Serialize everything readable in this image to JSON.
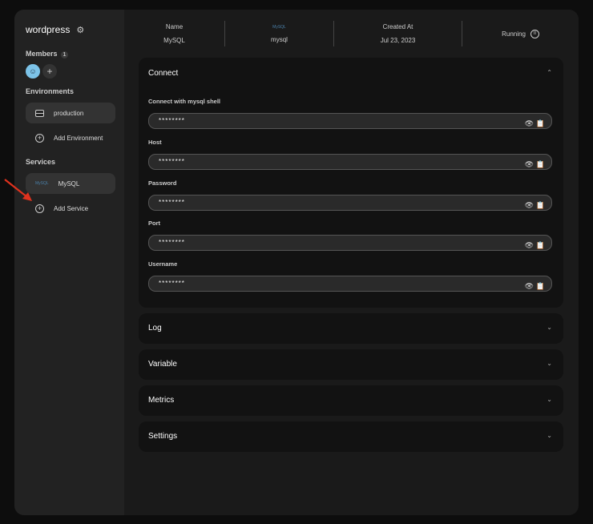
{
  "sidebar": {
    "project": "wordpress",
    "members_label": "Members",
    "members_count": "1",
    "environments_label": "Environments",
    "environments": [
      "production"
    ],
    "add_environment": "Add Environment",
    "services_label": "Services",
    "services": [
      "MySQL"
    ],
    "add_service": "Add Service"
  },
  "header": {
    "name_label": "Name",
    "name_value": "MySQL",
    "image": "mysql",
    "created_label": "Created At",
    "created_value": "Jul 23, 2023",
    "status": "Running"
  },
  "connect": {
    "title": "Connect",
    "fields": [
      {
        "label": "Connect with mysql shell",
        "value": "********"
      },
      {
        "label": "Host",
        "value": "********"
      },
      {
        "label": "Password",
        "value": "********"
      },
      {
        "label": "Port",
        "value": "********"
      },
      {
        "label": "Username",
        "value": "********"
      }
    ]
  },
  "sections": [
    "Log",
    "Variable",
    "Metrics",
    "Settings"
  ]
}
